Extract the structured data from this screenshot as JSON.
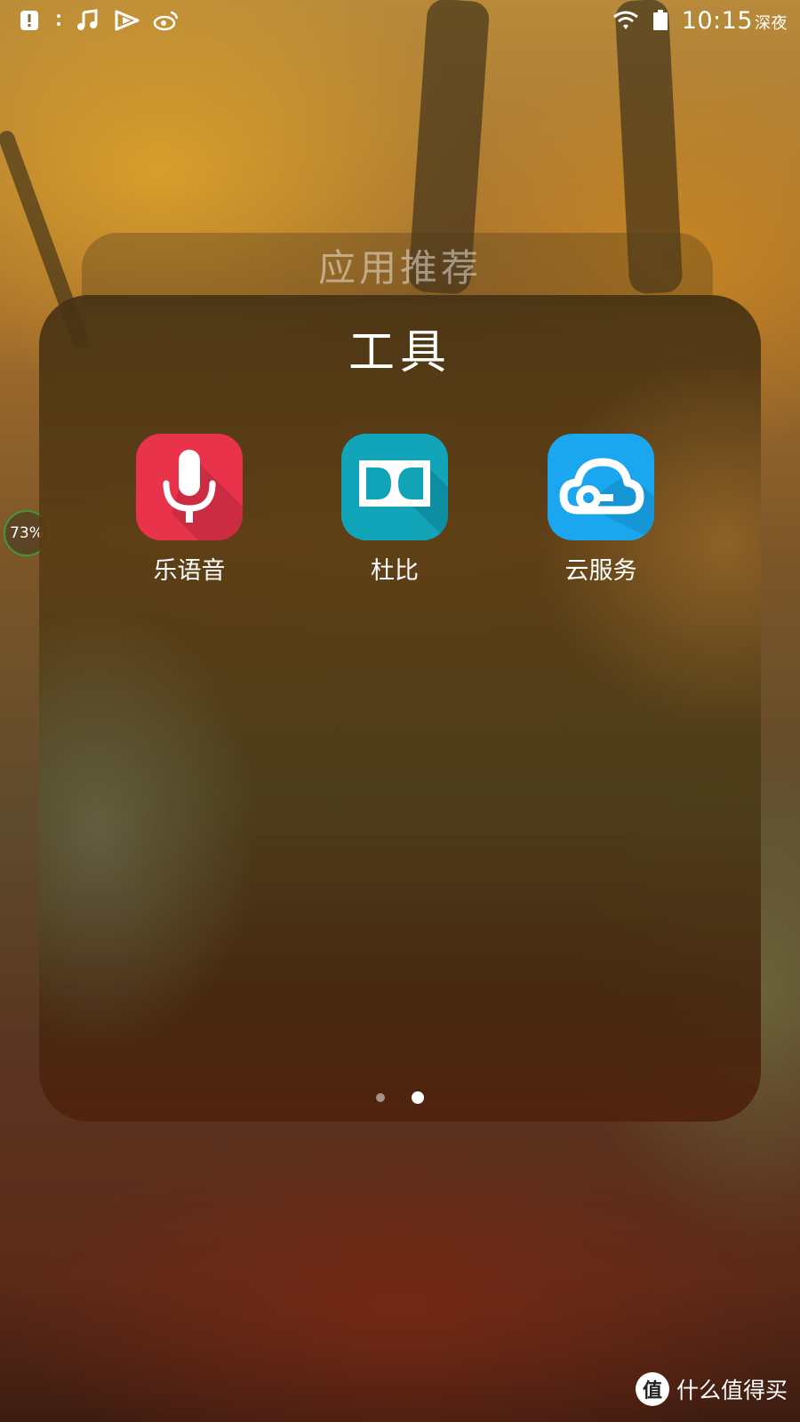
{
  "status_bar": {
    "left_icons": [
      "notification-alert-icon",
      "more-dots-icon",
      "music-note-icon",
      "video-play-icon",
      "weibo-icon"
    ],
    "right_icons": [
      "wifi-icon",
      "battery-icon"
    ],
    "time": "10:15",
    "period": "深夜"
  },
  "background_folder": {
    "title": "应用推荐"
  },
  "folder": {
    "title": "工具",
    "apps": [
      {
        "label": "乐语音",
        "icon": "microphone-icon",
        "color": "#e8334a"
      },
      {
        "label": "杜比",
        "icon": "dolby-icon",
        "color": "#11a3b8"
      },
      {
        "label": "云服务",
        "icon": "cloud-icon",
        "color": "#1aa7ef"
      }
    ],
    "page_count": 2,
    "active_page": 2
  },
  "floating_ball": {
    "text": "73%",
    "accent": "#3e9a3a"
  },
  "watermark": {
    "logo_text": "值",
    "text": "什么值得买"
  }
}
